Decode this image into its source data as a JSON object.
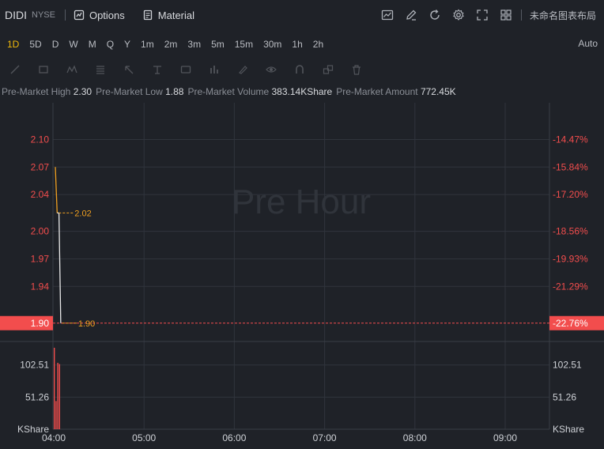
{
  "header": {
    "symbol": "DIDI",
    "exchange": "NYSE",
    "options_label": "Options",
    "material_label": "Material",
    "layout_label": "未命名图表布局"
  },
  "intervals": [
    "1D",
    "5D",
    "D",
    "W",
    "M",
    "Q",
    "Y",
    "1m",
    "2m",
    "3m",
    "5m",
    "15m",
    "30m",
    "1h",
    "2h"
  ],
  "active_interval": "1D",
  "auto_label": "Auto",
  "stats": [
    {
      "label": "Pre-Market High",
      "value": "2.30"
    },
    {
      "label": "Pre-Market Low",
      "value": "1.88"
    },
    {
      "label": "Pre-Market Volume",
      "value": "383.14KShare"
    },
    {
      "label": "Pre-Market Amount",
      "value": "772.45K"
    }
  ],
  "chart_data": {
    "type": "line",
    "watermark": "Pre Hour",
    "price": {
      "x": [
        "04:00",
        "04:01",
        "04:02",
        "04:03"
      ],
      "y": [
        2.07,
        2.02,
        2.02,
        1.9
      ],
      "ylim": [
        1.88,
        2.14
      ],
      "left_ticks": [
        "2.10",
        "2.07",
        "2.04",
        "2.00",
        "1.97",
        "1.94"
      ],
      "left_tick_values": [
        2.1,
        2.07,
        2.04,
        2.0,
        1.97,
        1.94
      ],
      "right_ticks": [
        "-14.47%",
        "-15.84%",
        "-17.20%",
        "-18.56%",
        "-19.93%",
        "-21.29%"
      ],
      "current_price": "1.90",
      "current_pct": "-22.76%",
      "current_value": 1.9,
      "annotations": [
        {
          "label": "2.02",
          "value": 2.02
        },
        {
          "label": "1.90",
          "value": 1.9
        }
      ]
    },
    "volume": {
      "unit": "KShare",
      "ticks": [
        "102.51",
        "51.26"
      ],
      "tick_values": [
        102.51,
        51.26
      ],
      "ylim": [
        0,
        140
      ],
      "bars": [
        130,
        45,
        106,
        104
      ]
    },
    "x_ticks": [
      "04:00",
      "05:00",
      "06:00",
      "07:00",
      "08:00",
      "09:00"
    ],
    "colors": {
      "price_up": "#f0a020",
      "price_line": "#e8e8e8",
      "down": "#f24d4d",
      "grid": "#30343c",
      "current_bg": "#f24d4d"
    }
  }
}
